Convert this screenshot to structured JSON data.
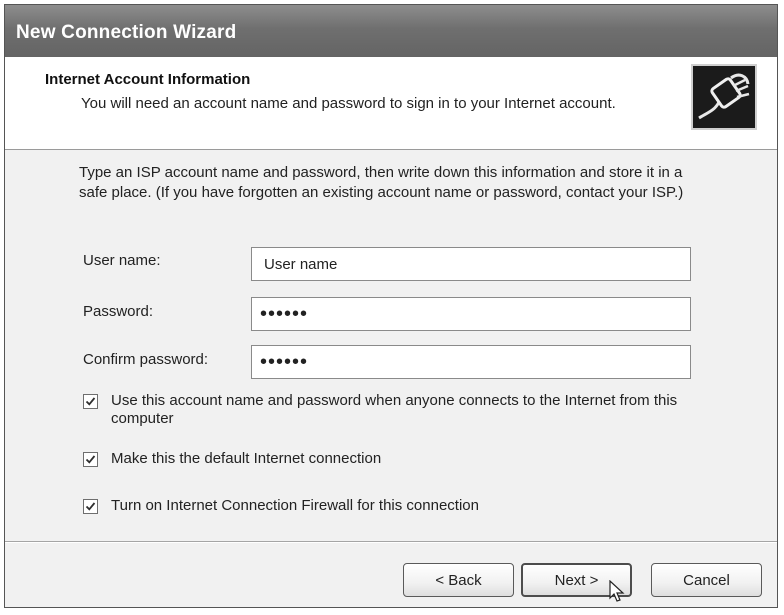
{
  "window": {
    "title": "New Connection Wizard"
  },
  "header": {
    "title": "Internet Account Information",
    "subtitle": "You will need an account name and password to sign in to your Internet account.",
    "icon": "network-cable-icon"
  },
  "intro": {
    "line1": "Type an ISP account name and password, then write down this information and store it in a",
    "line2": "safe place. (If you have forgotten an existing account name or password, contact your ISP.)"
  },
  "fields": {
    "username": {
      "label": "User name:",
      "value": "User name"
    },
    "password": {
      "label": "Password:",
      "value": "••••••"
    },
    "confirm": {
      "label": "Confirm password:",
      "value": "••••••"
    }
  },
  "options": [
    {
      "label": "Use this account  name and password when anyone connects to the Internet from this computer",
      "checked": true
    },
    {
      "label": "Make this the default Internet connection",
      "checked": true
    },
    {
      "label": "Turn on Internet Connection Firewall for this connection",
      "checked": true
    }
  ],
  "buttons": {
    "back": "< Back",
    "next": "Next >",
    "cancel": "Cancel"
  }
}
